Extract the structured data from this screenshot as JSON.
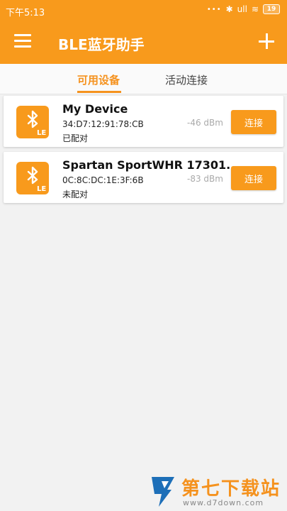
{
  "status_bar": {
    "time": "下午5:13",
    "dots": "•••",
    "bluetooth": "✱",
    "signal": "ull",
    "wifi": "≋",
    "battery": "19"
  },
  "app_bar": {
    "title": "BLE蓝牙助手",
    "menu_icon": "hamburger-menu-icon",
    "add_icon": "plus-icon"
  },
  "tabs": [
    {
      "label": "可用设备",
      "active": true
    },
    {
      "label": "活动连接",
      "active": false
    }
  ],
  "devices": [
    {
      "name": "My Device",
      "mac": "34:D7:12:91:78:CB",
      "pair_status": "已配对",
      "rssi": "-46 dBm",
      "connect_label": "连接"
    },
    {
      "name": "Spartan SportWHR 17301...",
      "mac": "0C:8C:DC:1E:3F:6B",
      "pair_status": "未配对",
      "rssi": "-83 dBm",
      "connect_label": "连接"
    }
  ],
  "watermark": {
    "title": "第七下载站",
    "url": "www.d7down.com"
  },
  "colors": {
    "accent": "#f89a1c",
    "background": "#f2f2f2"
  }
}
